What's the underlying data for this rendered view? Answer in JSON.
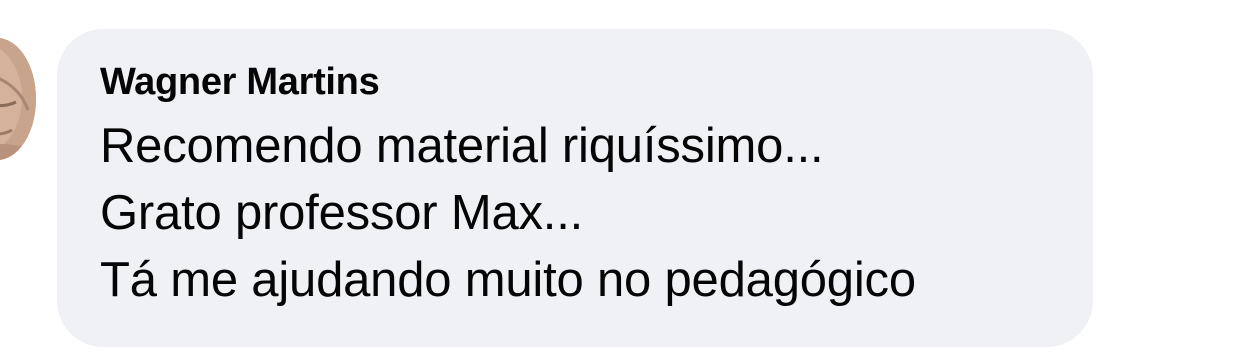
{
  "comment": {
    "author": "Wagner Martins",
    "lines": [
      "Recomendo material riquíssimo...",
      "Grato professor Max...",
      "Tá me ajudando muito no pedagógico"
    ]
  },
  "avatar": {
    "icon": "user-avatar",
    "skin_color": "#c9a58e"
  },
  "colors": {
    "bubble_background": "#f0f1f5",
    "text": "#050505",
    "page_background": "#ffffff"
  }
}
